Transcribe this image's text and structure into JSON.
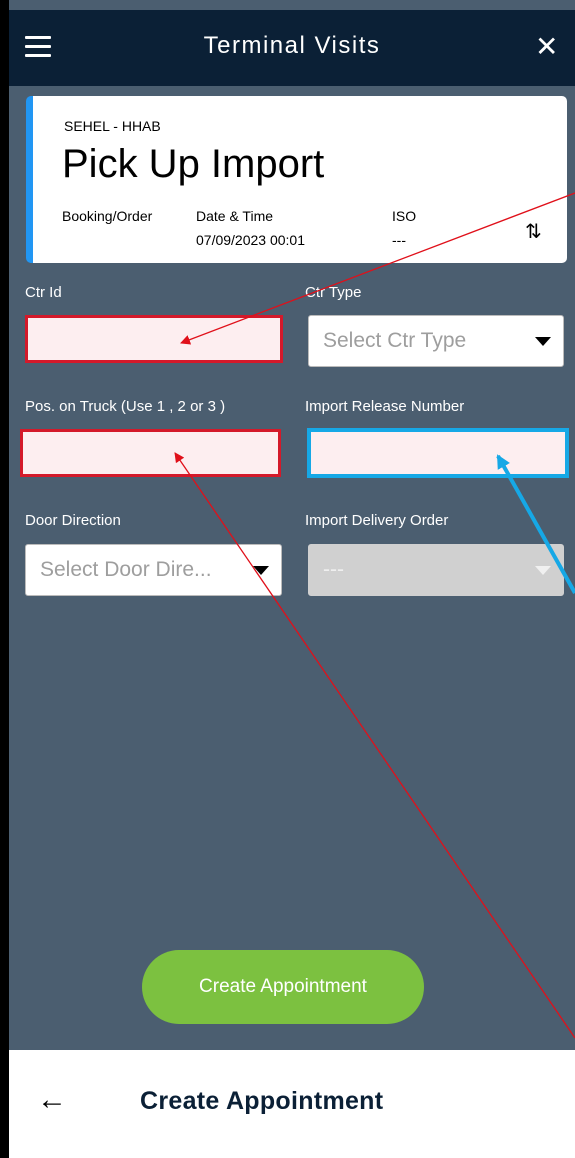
{
  "header": {
    "title": "Terminal Visits",
    "menu_icon": "hamburger-menu-icon",
    "close_icon": "close-icon",
    "close_glyph": "✕"
  },
  "visit_card": {
    "terminal_code": "SEHEL - HHAB",
    "visit_type": "Pick Up Import",
    "booking_label": "Booking/Order",
    "booking_value": "",
    "datetime_label": "Date & Time",
    "datetime_value": "07/09/2023 00:01",
    "iso_label": "ISO",
    "iso_value": "---",
    "swap_icon": "swap-vertical-icon",
    "swap_glyph": "⇅"
  },
  "form": {
    "ctr_id": {
      "label": "Ctr Id",
      "value": ""
    },
    "ctr_type": {
      "label": "Ctr Type",
      "placeholder": "Select Ctr Type"
    },
    "pos_on_truck": {
      "label": "Pos. on Truck (Use 1 , 2 or 3 )",
      "value": ""
    },
    "import_release_number": {
      "label": "Import Release Number",
      "value": ""
    },
    "door_direction": {
      "label": "Door Direction",
      "placeholder": "Select Door Dire..."
    },
    "import_delivery_order": {
      "label": "Import Delivery Order",
      "placeholder": "---"
    }
  },
  "actions": {
    "create_appointment_label": "Create Appointment"
  },
  "bottom_bar": {
    "back_glyph": "←",
    "back_icon": "back-arrow-icon",
    "title": "Create Appointment"
  },
  "colors": {
    "header_bg": "#0b2036",
    "body_bg": "#4b5e70",
    "accent_blue": "#2196f3",
    "error_red": "#d4192a",
    "highlight_blue": "#16a8e6",
    "button_green": "#7cc140",
    "annotation_red": "#e0101a"
  }
}
